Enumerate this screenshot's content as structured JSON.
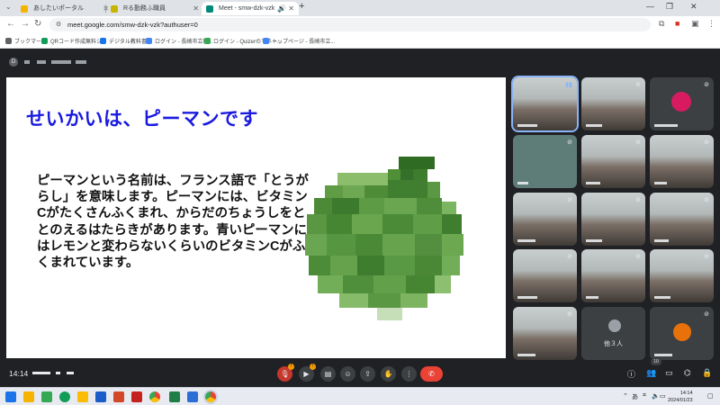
{
  "browser": {
    "tabs": [
      {
        "title": "あしたいポータル",
        "active": false,
        "color": "#f4b400"
      },
      {
        "title": "Rる勤務ふ職員",
        "active": false,
        "color": "#c9b400"
      },
      {
        "title": "Meet - smw-dzk-vzk",
        "active": true,
        "color": "#00897b"
      }
    ],
    "url": "meet.google.com/smw-dzk-vzk?authuser=0",
    "bookmarks": [
      {
        "label": "ブックマーク",
        "color": "#5f6368"
      },
      {
        "label": "QRコード作成無料ジ...",
        "color": "#0f9d58"
      },
      {
        "label": "デジタル教科書",
        "color": "#1a73e8"
      },
      {
        "label": "ログイン - 長崎市立教...",
        "color": "#4285f4"
      },
      {
        "label": "ログイン - Quizerのマネー...",
        "color": "#34a853"
      },
      {
        "label": "トップページ - 長崎市立...",
        "color": "#4285f4"
      }
    ]
  },
  "meeting": {
    "code_initial": "D",
    "slide": {
      "title": "せいかいは、ピーマンです",
      "body": "ピーマンという名前は、フランス語で「とうがらし」を意味します。ピーマンには、ビタミンCがたくさんふくまれ、からだのちょうしをととのえるはたらきがあります。青いピーマンにはレモンと変わらないくらいのビタミンCがふくまれています。"
    },
    "others_label": "他３人",
    "time": "14:14",
    "participant_count": "10"
  },
  "colors": {
    "meet_bg": "#202124",
    "slide_title": "#1a1ae0",
    "end_call": "#ea4335",
    "accent_blue": "#8ab4f8"
  },
  "taskbar": {
    "time": "14:14",
    "date": "2024/01/23"
  }
}
